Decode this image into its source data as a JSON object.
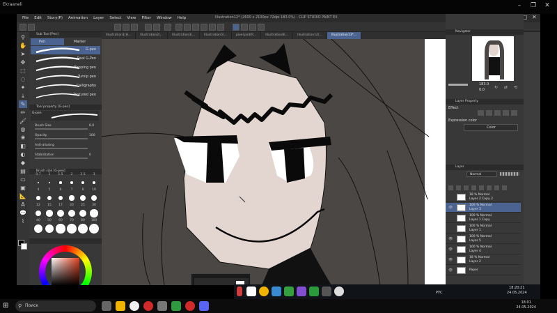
{
  "host": {
    "title": "Ekraaneli",
    "search_placeholder": "Поиск",
    "clock_time": "18:01",
    "clock_date": "24.05.2024"
  },
  "app": {
    "caption": "Illustration12* (2600 x 2100px 72dpi 183.0%) - CLIP STUDIO PAINT EX",
    "menus": [
      "File",
      "Edit",
      "Story(P)",
      "Animation",
      "Layer",
      "Select",
      "View",
      "Filter",
      "Window",
      "Help"
    ],
    "tabs": [
      "Illustration1(H...",
      "Illustration2(...",
      "Illustration3(...",
      "Illustration5(...",
      "pixel.psd(R...",
      "Illustration8(...",
      "Illustration12(...",
      "Illustration13*..."
    ],
    "subtool": {
      "header": "Sub Tool [Pen]",
      "tab_pen": "Pen",
      "tab_marker": "Marker",
      "brushes": [
        "G-pen",
        "Real G-Pen",
        "Mapping pen",
        "Turnip pen",
        "Calligraphy",
        "Textured pen"
      ],
      "selected_brush": "G-pen",
      "prop_header": "Tool property [G-pen]",
      "prop_preview": "G-pen",
      "props": [
        {
          "label": "Brush Size",
          "value": "8.0"
        },
        {
          "label": "Opacity",
          "value": "100"
        },
        {
          "label": "Anti-aliasing",
          "value": ""
        },
        {
          "label": "Stabilization",
          "value": "0"
        }
      ],
      "size_header": "Brush size [G-pen]",
      "size_labels": [
        "0.7",
        "1",
        "1.5",
        "2",
        "2.5",
        "3",
        "4",
        "5",
        "6",
        "7",
        "8",
        "10",
        "12",
        "15",
        "17",
        "20",
        "25",
        "30",
        "40",
        "50",
        "60",
        "70",
        "80",
        "100"
      ]
    },
    "navigator": {
      "header": "Navigator",
      "zoom": "183.0",
      "angle": "0.0"
    },
    "layer_property": {
      "header": "Layer Property",
      "effect": "Effect",
      "expression_color": "Expression color",
      "color": "Color"
    },
    "layer_panel": {
      "header": "Layer",
      "blend": "Normal",
      "opacity": "100"
    },
    "layers": [
      {
        "pct": "18 % Normal",
        "name": "Layer 2 Copy 2",
        "visible": false,
        "selected": false
      },
      {
        "pct": "100 % Normal",
        "name": "Layer 3",
        "visible": true,
        "selected": true
      },
      {
        "pct": "100 % Normal",
        "name": "Layer 1 Copy",
        "visible": false,
        "selected": false
      },
      {
        "pct": "100 % Normal",
        "name": "Layer 1",
        "visible": false,
        "selected": false
      },
      {
        "pct": "100 % Normal",
        "name": "Layer 5",
        "visible": true,
        "selected": false
      },
      {
        "pct": "100 % Normal",
        "name": "Layer 4",
        "visible": true,
        "selected": false
      },
      {
        "pct": "18 % Normal",
        "name": "Layer 2",
        "visible": true,
        "selected": false
      },
      {
        "pct": "",
        "name": "Paper",
        "visible": true,
        "selected": false
      }
    ],
    "tray": {
      "lang": "РУС",
      "time": "18:20:21",
      "date": "24.05.2024"
    }
  },
  "colors": {
    "accent": "#4b6390",
    "skin": "#e3d5cf",
    "hair": "#4b4744",
    "ink": "#000000"
  }
}
